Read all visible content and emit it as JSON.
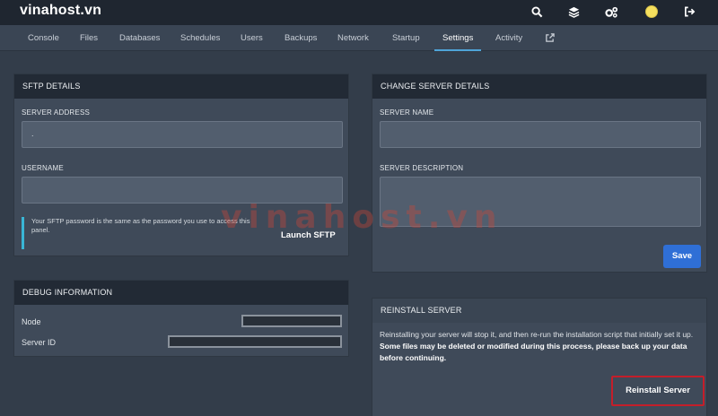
{
  "brand": "vinahost.vn",
  "top_icons": [
    "search-icon",
    "layers-icon",
    "servers-icon",
    "avatar-icon",
    "logout-icon"
  ],
  "tabs": [
    {
      "label": "Console"
    },
    {
      "label": "Files"
    },
    {
      "label": "Databases"
    },
    {
      "label": "Schedules"
    },
    {
      "label": "Users"
    },
    {
      "label": "Backups"
    },
    {
      "label": "Network"
    },
    {
      "label": "Startup"
    },
    {
      "label": "Settings"
    },
    {
      "label": "Activity"
    }
  ],
  "sftp": {
    "title": "SFTP DETAILS",
    "server_address_label": "SERVER ADDRESS",
    "server_address_value": ".",
    "username_label": "USERNAME",
    "username_value": "",
    "notice": "Your SFTP password is the same as the password you use to access this panel.",
    "launch_label": "Launch SFTP"
  },
  "change": {
    "title": "CHANGE SERVER DETAILS",
    "name_label": "SERVER NAME",
    "name_value": "",
    "desc_label": "SERVER DESCRIPTION",
    "desc_value": "",
    "save_label": "Save"
  },
  "debug": {
    "title": "DEBUG INFORMATION",
    "node_label": "Node",
    "server_id_label": "Server ID"
  },
  "reinstall": {
    "title": "REINSTALL SERVER",
    "desc_normal": "Reinstalling your server will stop it, and then re-run the installation script that initially set it up. ",
    "desc_bold": "Some files may be deleted or modified during this process, please back up your data before continuing.",
    "button_label": "Reinstall Server",
    "highlight_color": "#c41e2a"
  },
  "watermark": "vinahost.vn",
  "colors": {
    "accent": "#4fa4d8",
    "save": "#2f6fd6",
    "notice_bar": "#39b6d6"
  }
}
